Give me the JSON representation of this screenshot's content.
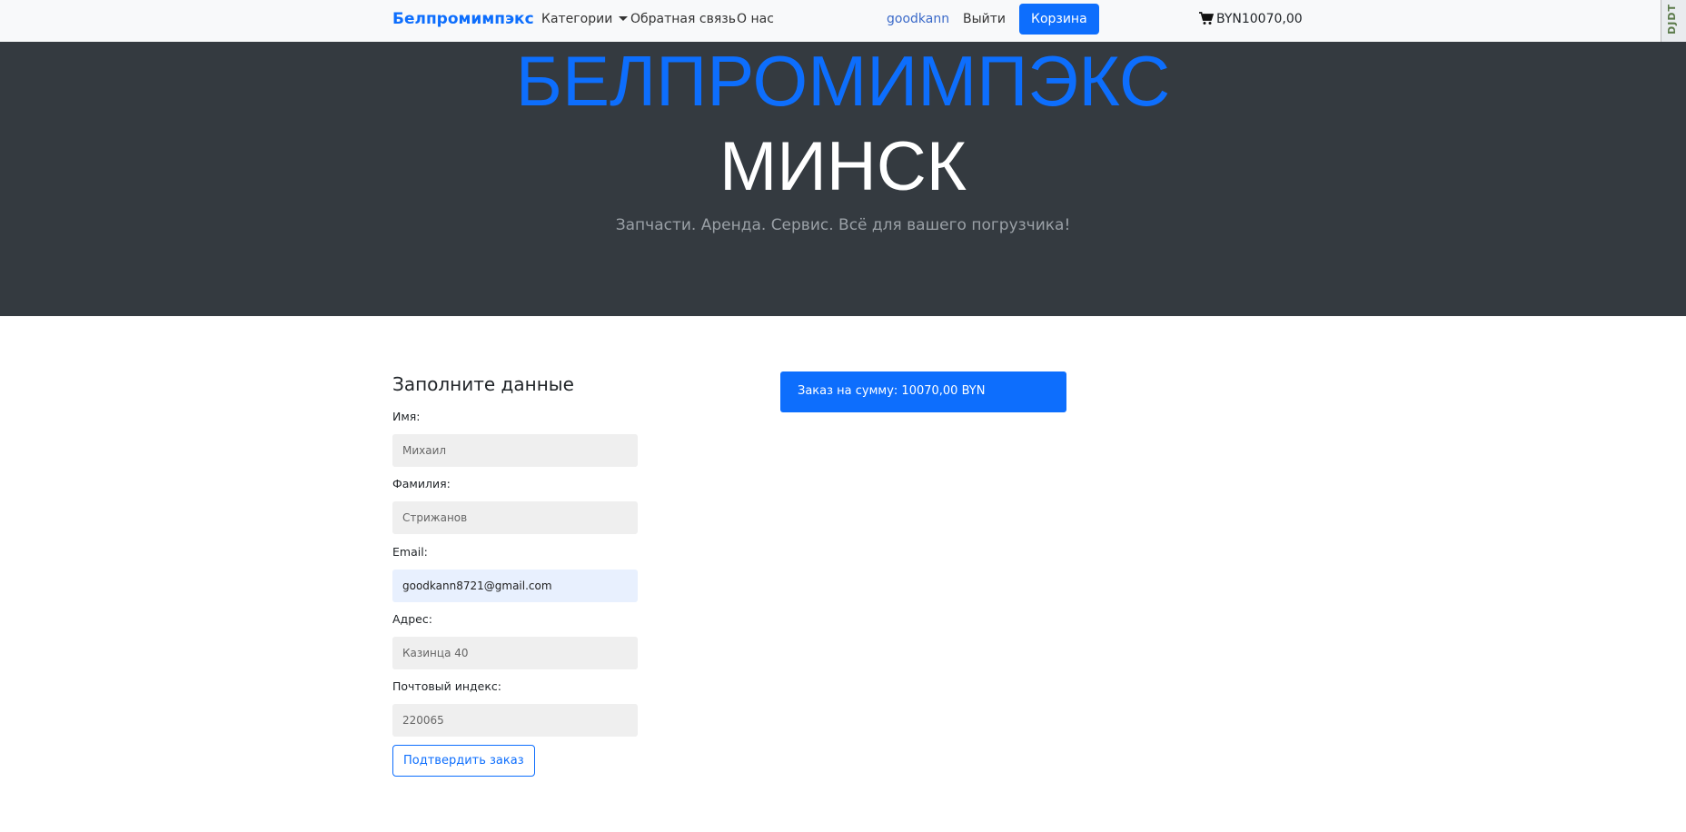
{
  "navbar": {
    "brand": "Белпромимпэкс",
    "links": {
      "categories": "Категории",
      "feedback": "Обратная связь",
      "about": "О нас"
    },
    "user": "goodkann",
    "logout": "Выйти",
    "cart_button": "Корзина",
    "cart_total": "BYN10070,00",
    "cart_icon": "shopping-cart-icon"
  },
  "side_tab": "DJDT",
  "hero": {
    "title": "БЕЛПРОМИМПЭКС",
    "city": "МИНСК",
    "tagline": "Запчасти. Аренда. Сервис. Всё для вашего погрузчика!"
  },
  "form": {
    "title": "Заполните данные",
    "fields": [
      {
        "label": "Имя:",
        "placeholder": "Михаил",
        "value": ""
      },
      {
        "label": "Фамилия:",
        "placeholder": "Стрижанов",
        "value": ""
      },
      {
        "label": "Email:",
        "placeholder": "",
        "value": "goodkann8721@gmail.com"
      },
      {
        "label": "Адрес:",
        "placeholder": "Казинца 40",
        "value": ""
      },
      {
        "label": "Почтовый индекс:",
        "placeholder": "220065",
        "value": ""
      }
    ],
    "submit": "Подтвердить заказ"
  },
  "order": {
    "summary": "Заказ на сумму: 10070,00 BYN"
  },
  "colors": {
    "accent": "#0d6efd",
    "hero_bg": "#343a40",
    "navbar_bg": "#f8f9fa"
  }
}
